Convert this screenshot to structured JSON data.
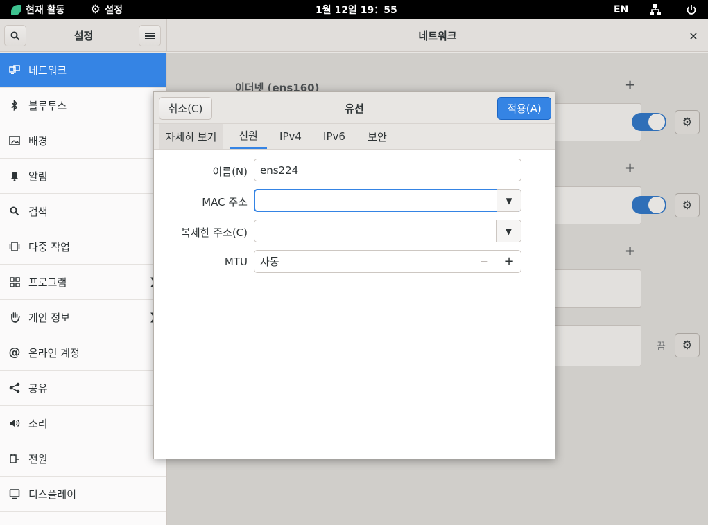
{
  "topbar": {
    "activities": "현재 활동",
    "app_menu": "설정",
    "clock": "1월 12일 19：55",
    "lang": "EN"
  },
  "sidebar": {
    "title": "설정",
    "items": [
      {
        "label": "네트워크",
        "icon": "network-icon"
      },
      {
        "label": "블루투스",
        "icon": "bluetooth-icon"
      },
      {
        "label": "배경",
        "icon": "background-icon"
      },
      {
        "label": "알림",
        "icon": "bell-icon"
      },
      {
        "label": "검색",
        "icon": "search-icon"
      },
      {
        "label": "다중 작업",
        "icon": "multitasking-icon"
      },
      {
        "label": "프로그램",
        "icon": "apps-grid-icon"
      },
      {
        "label": "개인 정보",
        "icon": "hand-icon"
      },
      {
        "label": "온라인 계정",
        "icon": "at-icon"
      },
      {
        "label": "공유",
        "icon": "share-icon"
      },
      {
        "label": "소리",
        "icon": "speaker-icon"
      },
      {
        "label": "전원",
        "icon": "power-plug-icon"
      },
      {
        "label": "디스플레이",
        "icon": "display-icon"
      }
    ]
  },
  "main": {
    "title": "네트워크",
    "ethernet_section": "이더넷 (ens160)",
    "off_label": "끔"
  },
  "dialog": {
    "title": "유선",
    "cancel": "취소(C)",
    "apply": "적용(A)",
    "tabs": [
      "자세히 보기",
      "신원",
      "IPv4",
      "IPv6",
      "보안"
    ],
    "active_tab": "신원",
    "fields": {
      "name_label": "이름(N)",
      "name_value": "ens224",
      "mac_label": "MAC 주소",
      "mac_value": "",
      "cloned_label": "복제한 주소(C)",
      "cloned_value": "",
      "mtu_label": "MTU",
      "mtu_value": "자동"
    }
  },
  "colors": {
    "accent": "#3584e4",
    "topbar": "#000000",
    "logo": "#3ec28f"
  }
}
